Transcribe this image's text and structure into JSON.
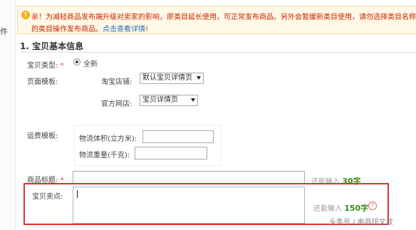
{
  "left_panel": {
    "fragment": "件"
  },
  "notice": {
    "line1": "亲！为减轻商品发布端升级对卖家的影响，原类目延长使用，可正常发布商品。另外会暂缓新类目使用，请勿选择类目名称后带",
    "line2_text": "的类目操作发布商品。",
    "line2_link": "点击查看详情",
    "line2_end": "!"
  },
  "section": {
    "title": "1. 宝贝基本信息"
  },
  "item_type": {
    "label": "宝贝类型:",
    "required": "*",
    "option": "全新"
  },
  "page_template": {
    "label": "页面模板:",
    "taobao_label": "淘宝店铺:",
    "taobao_value": "默认宝贝详情页",
    "official_label": "官方网店:",
    "official_value": "宝贝详情页"
  },
  "shipping_template": {
    "label": "运费模板:",
    "volume_label": "物流体积(立方米):",
    "weight_label": "物流重量(千克):"
  },
  "product_title": {
    "label": "商品标题:",
    "required": "*",
    "remaining_prefix": "还能输入",
    "remaining_count": "30字"
  },
  "selling_points": {
    "label": "宝贝卖点:",
    "remaining_prefix": "还能输入",
    "remaining_count": "150字",
    "help_glyph": "?"
  },
  "watermark": {
    "text": "头条号 / 电商扭文波"
  }
}
